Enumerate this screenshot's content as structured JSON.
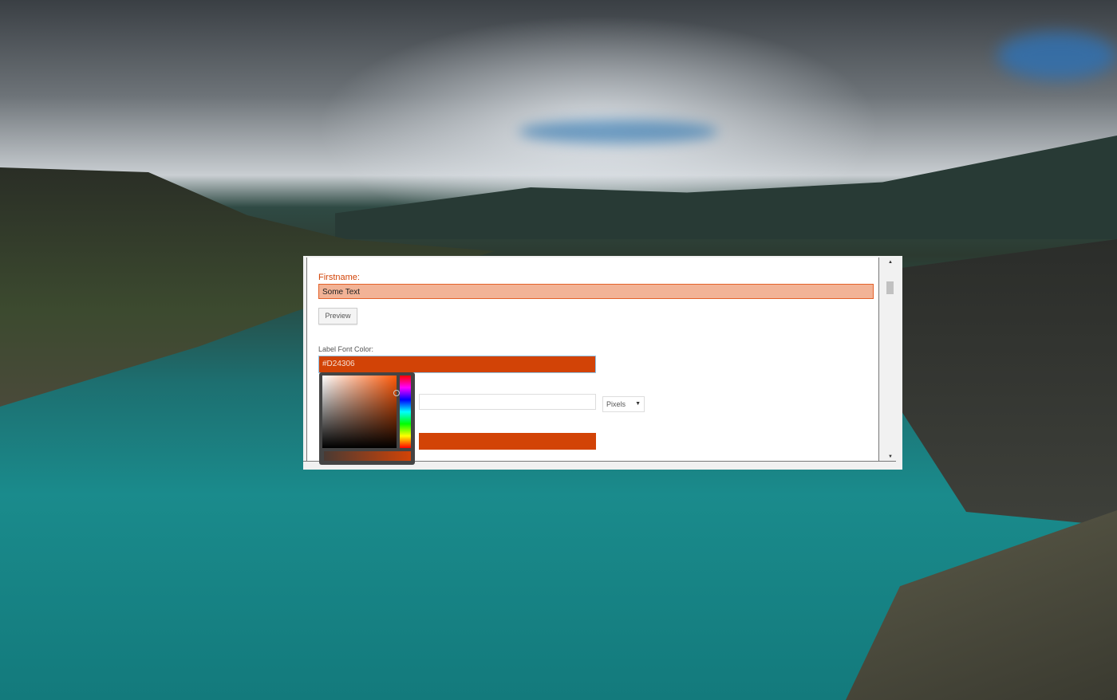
{
  "form": {
    "firstname_label": "Firstname:",
    "firstname_value": "Some Text",
    "preview_button": "Preview",
    "label_font_color_label": "Label Font Color:",
    "label_font_color_value": "#D24306",
    "unit_select": "Pixels",
    "dropdown_arrow": "▼"
  },
  "scrollbar": {
    "up": "▲",
    "down": "▼"
  },
  "colors": {
    "accent": "#D24306",
    "input_fill": "#F2B396"
  }
}
